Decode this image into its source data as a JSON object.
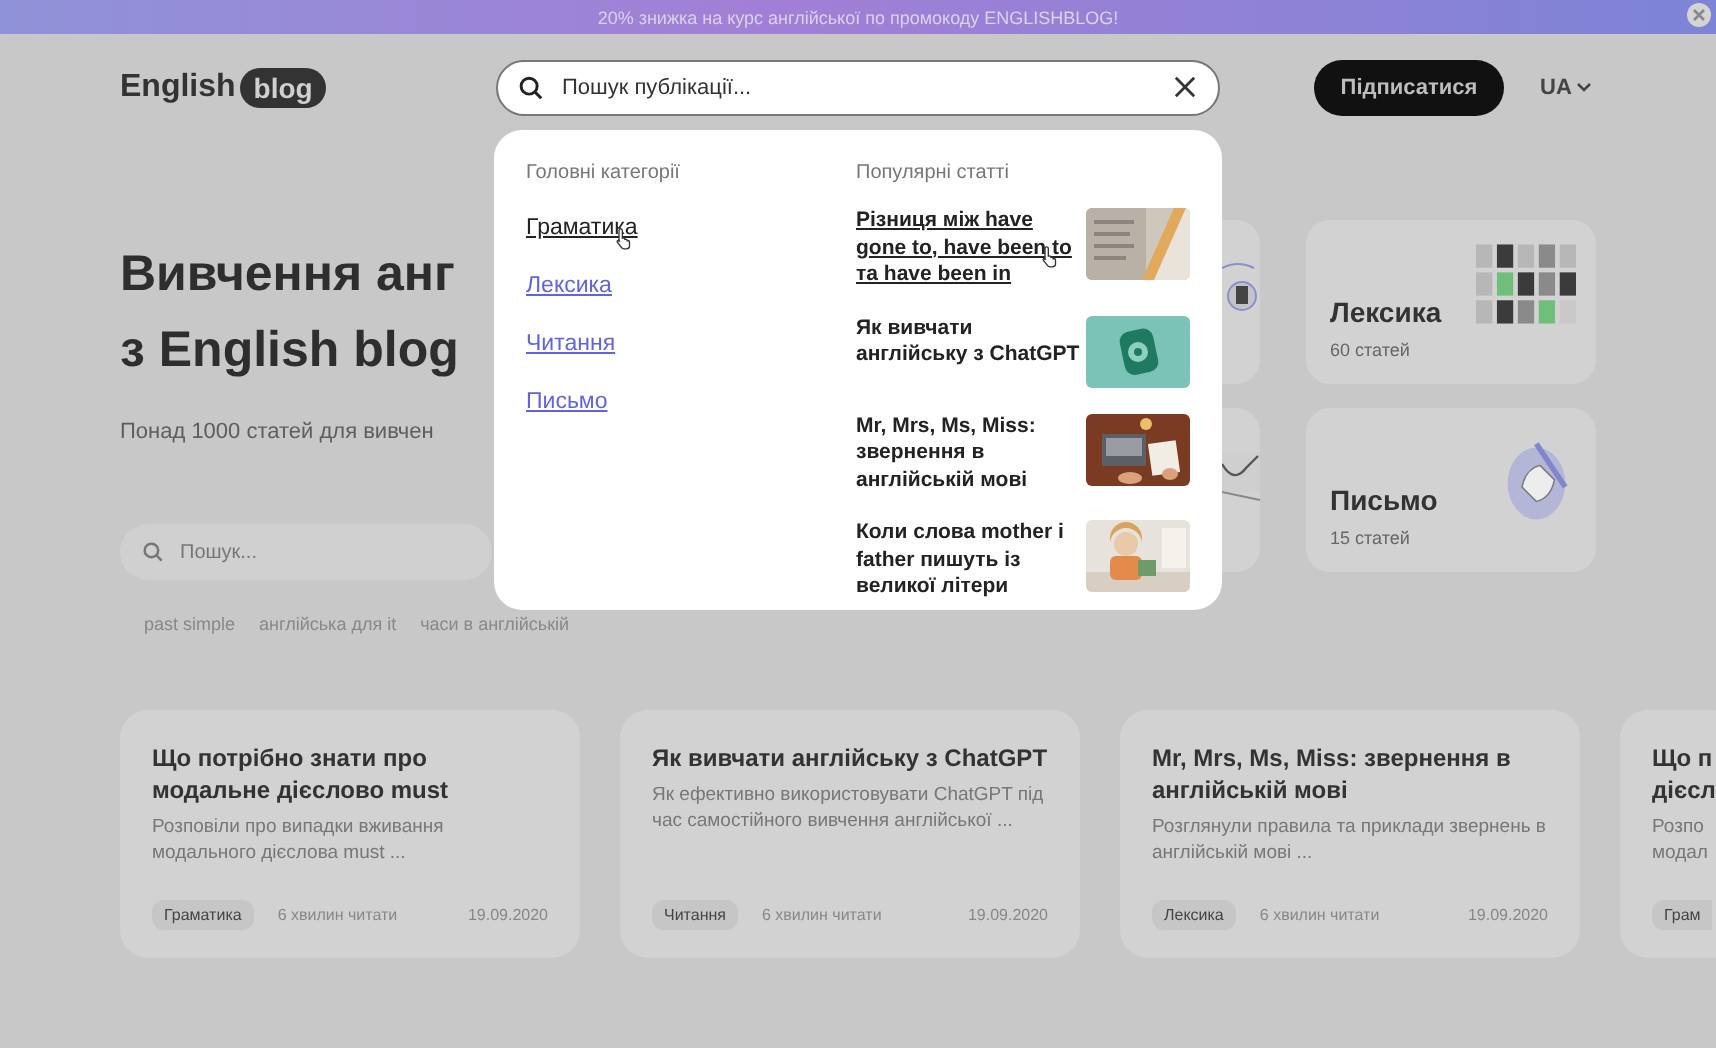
{
  "banner": {
    "text": "20% знижка на курс англійської по промокоду ENGLISHBLOG!"
  },
  "header": {
    "logo": {
      "word": "English",
      "badge": "blog"
    },
    "search": {
      "placeholder": "Пошук публікації..."
    },
    "subscribe_button": "Підписатися",
    "language": "UA"
  },
  "hero": {
    "title_lines": [
      "Вивчення анг",
      "з English blog"
    ],
    "subtitle": "Понад 1000 статей для вивчен",
    "search": {
      "placeholder": "Пошук..."
    },
    "tags": [
      "past simple",
      "англійська для it",
      "часи в англійській"
    ]
  },
  "categories": [
    {
      "name": "Лексика",
      "count": "60 статей"
    },
    {
      "name": "Письмо",
      "count": "15 статей"
    }
  ],
  "articles": [
    {
      "kind": "full",
      "title": "Що потрібно знати про модальне дієслово must",
      "description": "Розповіли про випадки вживання модального дієслова must ...",
      "tag": "Граматика",
      "read_time": "6 хвилин читати",
      "date": "19.09.2020"
    },
    {
      "kind": "full",
      "title": "Як вивчати англійську з ChatGPT",
      "description": "Як ефективно використовувати ChatGPT під час самостійного вивчення англійської ...",
      "tag": "Читання",
      "read_time": "6 хвилин читати",
      "date": "19.09.2020"
    },
    {
      "kind": "full",
      "title": "Mr, Mrs, Ms, Miss: звернення в англійській мові",
      "description": "Розглянули правила та приклади звернень в англійській мові ...",
      "tag": "Лексика",
      "read_time": "6 хвилин читати",
      "date": "19.09.2020"
    },
    {
      "kind": "partial",
      "title_lines": [
        "Що п",
        "дієсл"
      ],
      "description_lines": [
        "Розпо",
        "модал"
      ],
      "tag": "Грам"
    }
  ],
  "dropdown": {
    "categories_heading": "Головні категорії",
    "categories": [
      {
        "label": "Граматика",
        "selected": true
      },
      {
        "label": "Лексика",
        "selected": false
      },
      {
        "label": "Читання",
        "selected": false
      },
      {
        "label": "Письмо",
        "selected": false
      }
    ],
    "popular_heading": "Популярні статті",
    "popular": [
      {
        "title": "Різниця між have gone to, have been to та have been in",
        "selected": true
      },
      {
        "title": "Як вивчати англійську з ChatGPT",
        "selected": false
      },
      {
        "title": "Mr, Mrs, Ms, Miss: звернення в англійській мові",
        "selected": false
      },
      {
        "title": "Коли слова mother і father пишуть із великої літери",
        "selected": false
      }
    ]
  }
}
